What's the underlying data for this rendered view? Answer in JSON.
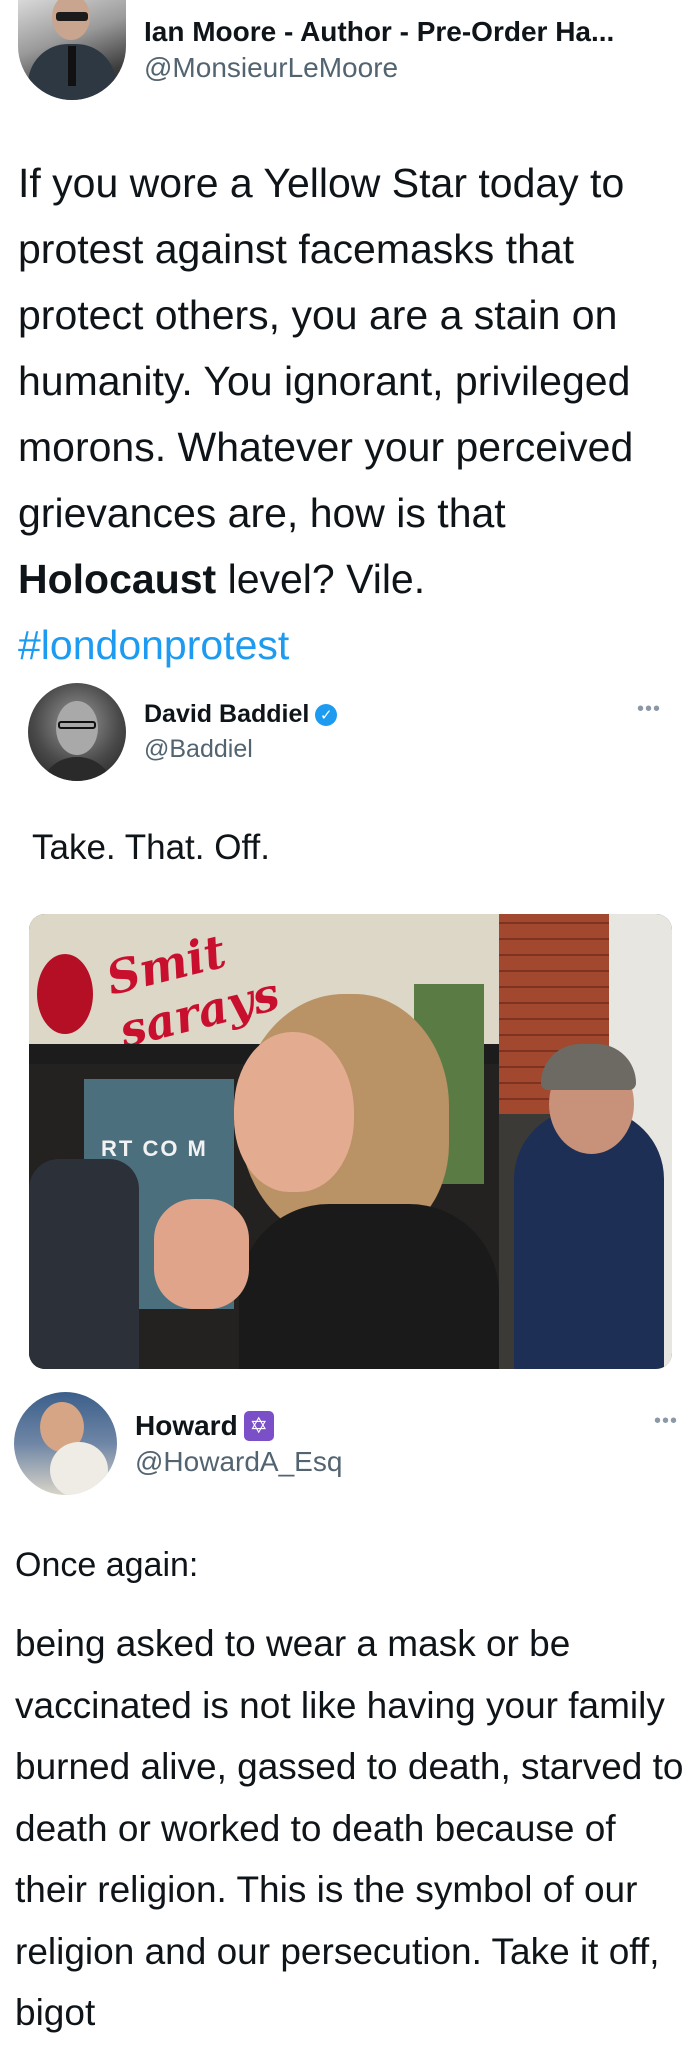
{
  "tweets": [
    {
      "display_name": "Ian Moore - Author - Pre-Order Ha...",
      "handle": "@MonsieurLeMoore",
      "text_before": "If you wore a Yellow Star today to protest against facemasks that protect others, you are a stain on humanity. You ignorant, privileged morons. Whatever your perceived grievances are, how is that ",
      "text_bold": "Holocaust",
      "text_after": " level? Vile.",
      "hashtag": "#londonprotest"
    },
    {
      "display_name": "David Baddiel",
      "handle": "@Baddiel",
      "verified_icon": "verified-check-icon",
      "more_icon": "more-options-icon",
      "more_glyph": "•••",
      "text": "Take. That. Off.",
      "photo_sign_text": "Smit sarays",
      "photo_window_text": "RT CO M"
    },
    {
      "display_name": "Howard",
      "handle": "@HowardA_Esq",
      "badge_icon": "star-of-david-icon",
      "badge_glyph": "✡",
      "more_icon": "more-options-icon",
      "more_glyph": "•••",
      "intro": "Once again:",
      "text": "being asked to wear a mask or be vaccinated is not like having your family burned alive, gassed to death, starved to death or worked to death because of their religion. This is the symbol of our religion and our persecution. Take it off, bigot"
    }
  ],
  "colors": {
    "hashtag": "#1d9bf0",
    "handle": "#536471",
    "verified": "#1d9bf0",
    "badge": "#7a4fc8"
  }
}
